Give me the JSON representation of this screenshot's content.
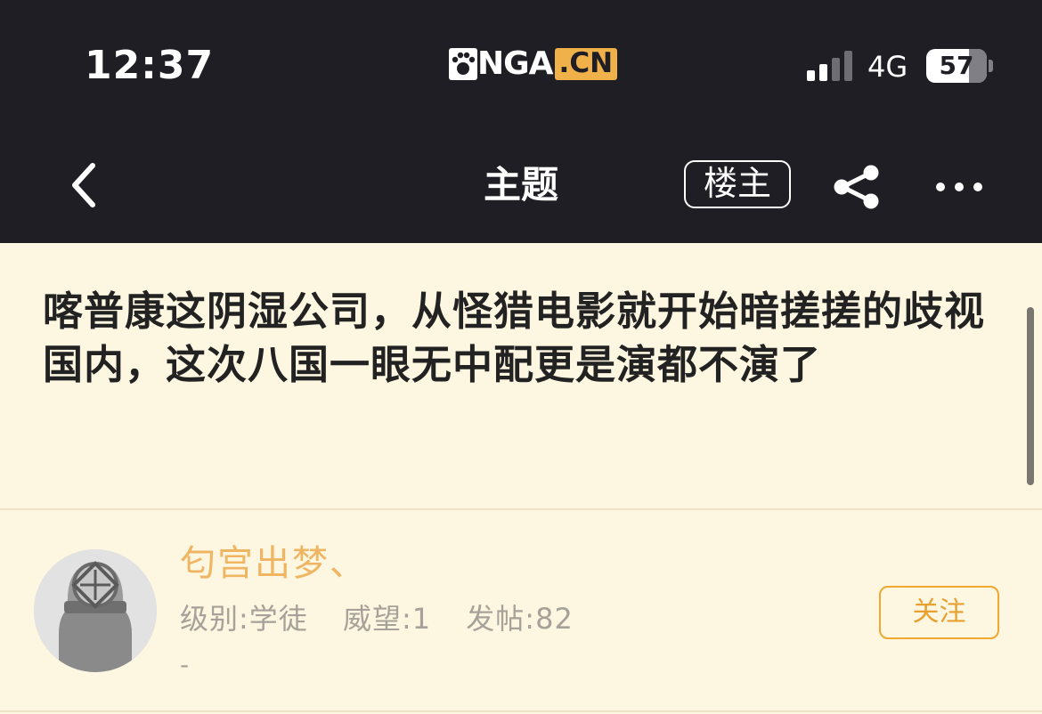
{
  "status_bar": {
    "time": "12:37",
    "network": "4G",
    "battery": "57",
    "logo_text": "NGA",
    "logo_suffix": ".CN"
  },
  "nav": {
    "title": "主题",
    "op_button": "楼主",
    "icons": [
      "back-chevron-icon",
      "share-icon",
      "more-icon"
    ]
  },
  "topic": {
    "title": "喀普康这阴湿公司，从怪猎电影就开始暗搓搓的歧视国内，这次八国一眼无中配更是演都不演了"
  },
  "author": {
    "name": "匂宫出梦、",
    "level": "级别:学徒",
    "prestige": "威望:1",
    "posts": "发帖:82",
    "extra": "-",
    "follow_label": "关注"
  },
  "colors": {
    "header_bg": "#1f1e24",
    "page_bg": "#fdf6e0",
    "accent": "#f0a830",
    "username": "#efb563"
  }
}
